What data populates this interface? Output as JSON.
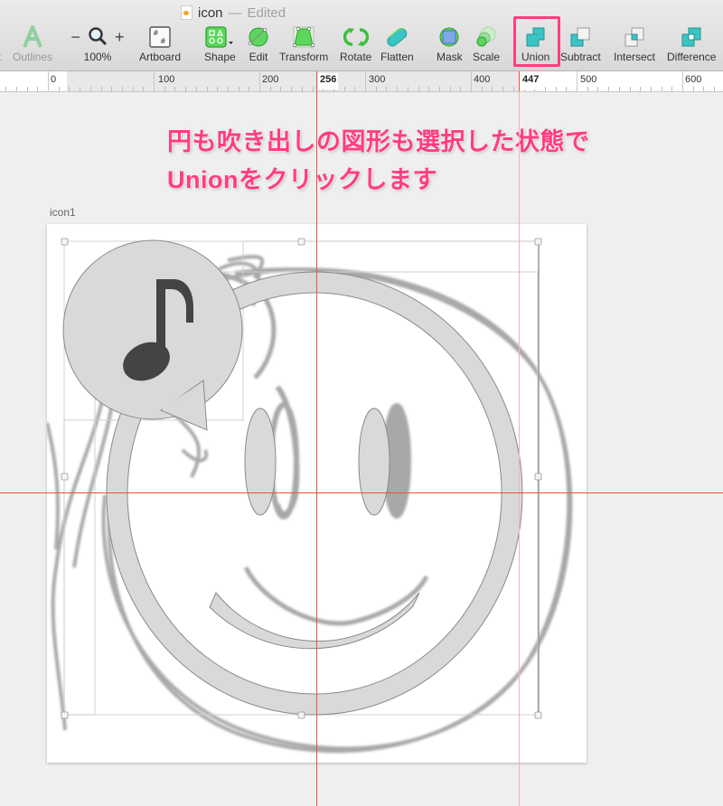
{
  "window": {
    "doc_name": "icon",
    "separator": "—",
    "status": "Edited"
  },
  "toolbar": {
    "partial_left_label": "t",
    "outlines": "Outlines",
    "zoom_minus": "−",
    "zoom_plus": "+",
    "zoom_level": "100%",
    "artboard": "Artboard",
    "shape": "Shape",
    "edit": "Edit",
    "transform": "Transform",
    "rotate": "Rotate",
    "flatten": "Flatten",
    "mask": "Mask",
    "scale": "Scale",
    "union": "Union",
    "subtract": "Subtract",
    "intersect": "Intersect",
    "difference": "Difference"
  },
  "ruler": {
    "ticks": [
      "0",
      "100",
      "200",
      "300",
      "400",
      "500",
      "600"
    ],
    "selection_start": "256",
    "selection_end": "447"
  },
  "annotation": {
    "line1": "円も吹き出しの図形も選択した状態で",
    "line2": "Unionをクリックします"
  },
  "artboard": {
    "name": "icon1"
  },
  "colors": {
    "accent_pink": "#ff3d7f",
    "guide_red": "#e8543a",
    "boolean_teal": "#3cc4c4",
    "tool_green": "#5cd65c"
  }
}
